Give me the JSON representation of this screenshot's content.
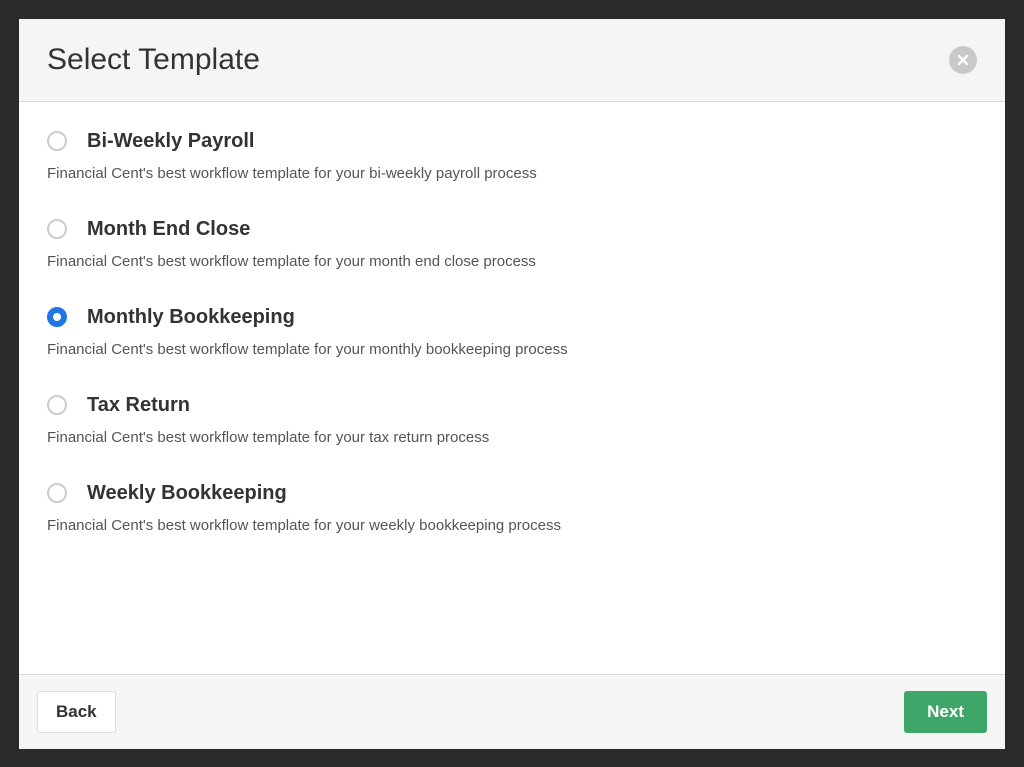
{
  "header": {
    "title": "Select Template"
  },
  "templates": [
    {
      "label": "Bi-Weekly Payroll",
      "description": "Financial Cent's best workflow template for your bi-weekly payroll process",
      "selected": false
    },
    {
      "label": "Month End Close",
      "description": "Financial Cent's best workflow template for your month end close process",
      "selected": false
    },
    {
      "label": "Monthly Bookkeeping",
      "description": "Financial Cent's best workflow template for your monthly bookkeeping process",
      "selected": true
    },
    {
      "label": "Tax Return",
      "description": "Financial Cent's best workflow template for your tax return process",
      "selected": false
    },
    {
      "label": "Weekly Bookkeeping",
      "description": "Financial Cent's best workflow template for your weekly bookkeeping process",
      "selected": false
    }
  ],
  "footer": {
    "back_label": "Back",
    "next_label": "Next"
  }
}
